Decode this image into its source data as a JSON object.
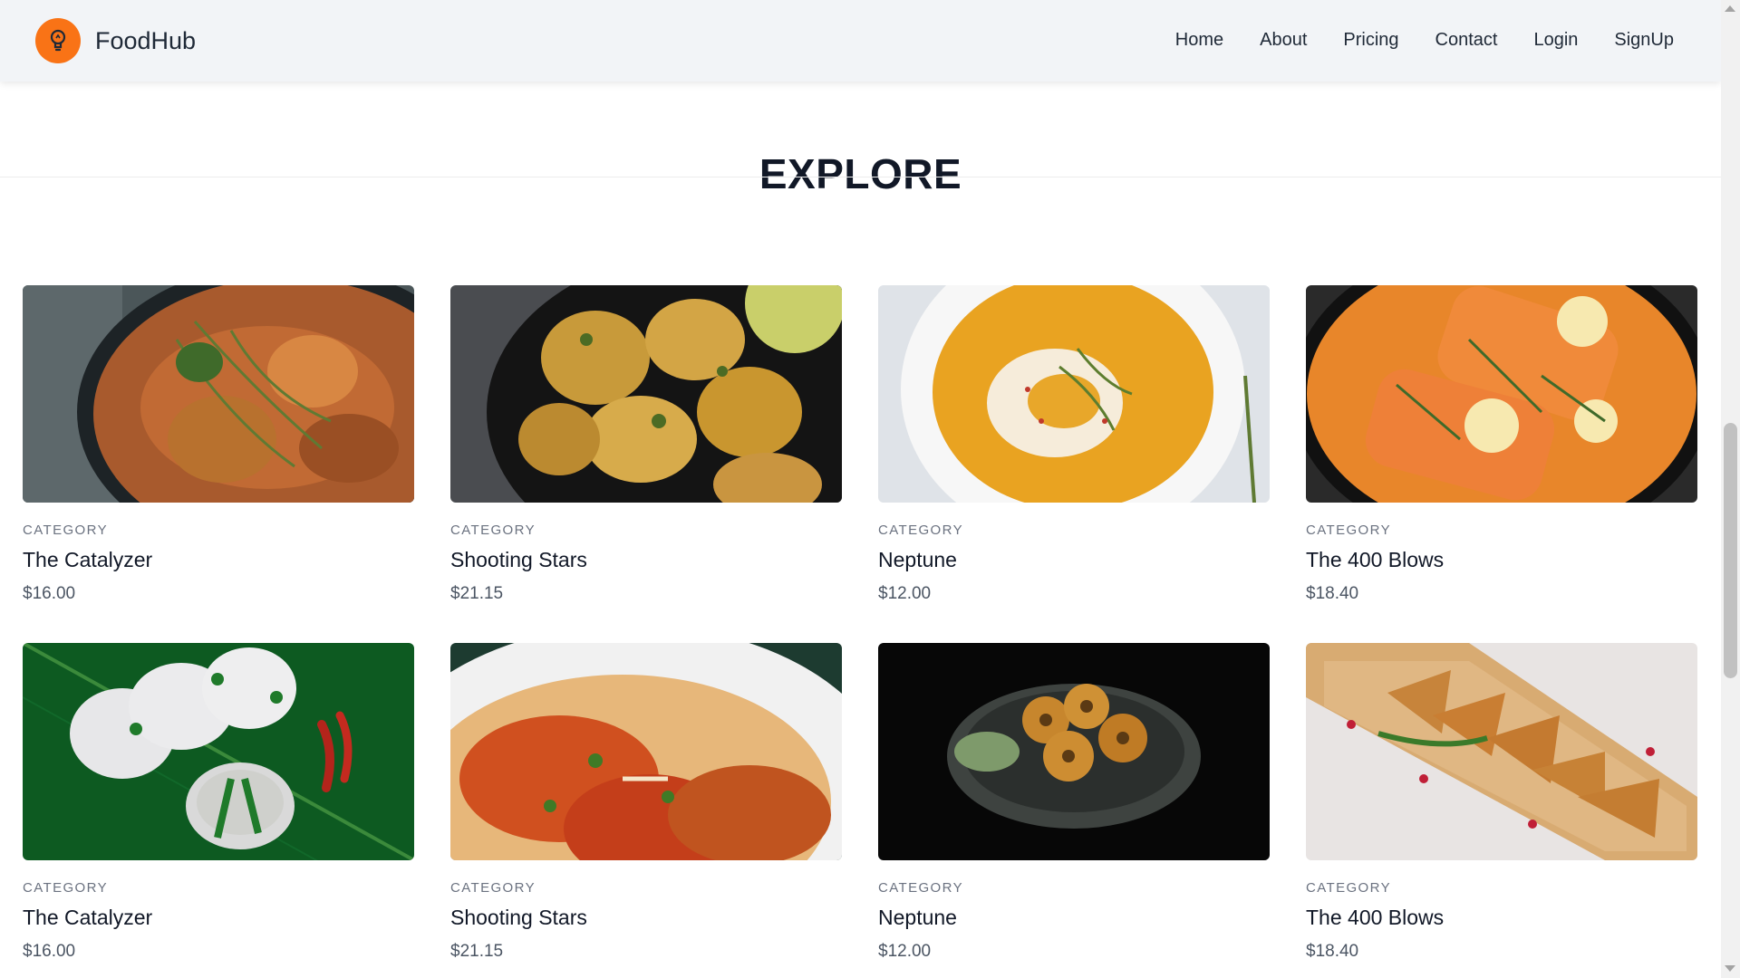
{
  "navbar": {
    "brand": "FoodHub",
    "links": [
      "Home",
      "About",
      "Pricing",
      "Contact",
      "Login",
      "SignUp"
    ]
  },
  "section": {
    "title": "EXPLORE"
  },
  "cards": [
    {
      "category": "CATEGORY",
      "name": "The Catalyzer",
      "price": "$16.00",
      "image": "curry-bowl"
    },
    {
      "category": "CATEGORY",
      "name": "Shooting Stars",
      "price": "$21.15",
      "image": "pakora-fritters"
    },
    {
      "category": "CATEGORY",
      "name": "Neptune",
      "price": "$12.00",
      "image": "yellow-soup"
    },
    {
      "category": "CATEGORY",
      "name": "The 400 Blows",
      "price": "$18.40",
      "image": "salmon-curry"
    },
    {
      "category": "CATEGORY",
      "name": "The Catalyzer",
      "price": "$16.00",
      "image": "idli-on-leaf"
    },
    {
      "category": "CATEGORY",
      "name": "Shooting Stars",
      "price": "$21.15",
      "image": "spaghetti-meatballs"
    },
    {
      "category": "CATEGORY",
      "name": "Neptune",
      "price": "$12.00",
      "image": "vada-plate"
    },
    {
      "category": "CATEGORY",
      "name": "The 400 Blows",
      "price": "$18.40",
      "image": "samosa-board"
    }
  ],
  "colors": {
    "accent": "#f97316",
    "navbar_bg": "#f2f4f7",
    "text": "#111827",
    "muted": "#6b7280"
  }
}
